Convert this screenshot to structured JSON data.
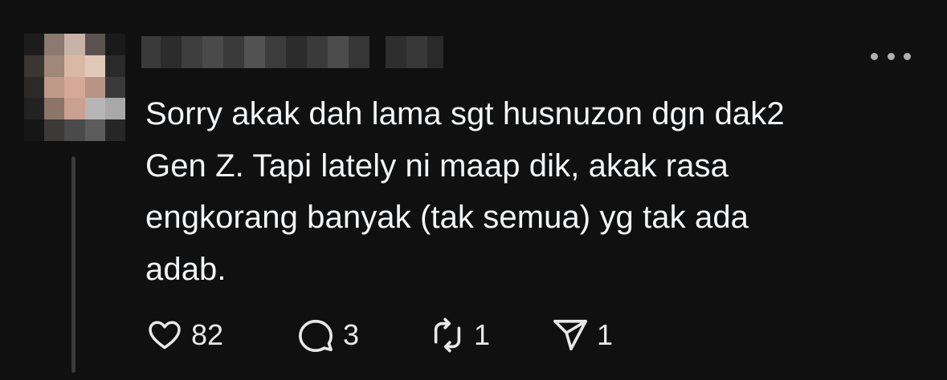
{
  "post": {
    "username_redacted": true,
    "text": "Sorry akak dah lama sgt husnuzon dgn dak2\nGen Z. Tapi lately ni maap dik, akak rasa\nengkorang banyak (tak semua) yg tak ada\nadab."
  },
  "menu": {
    "icon": "more-horizontal-icon"
  },
  "actions": {
    "like": {
      "icon": "heart-icon",
      "count": "82"
    },
    "reply": {
      "icon": "comment-icon",
      "count": "3"
    },
    "repost": {
      "icon": "repost-icon",
      "count": "1"
    },
    "share": {
      "icon": "send-icon",
      "count": "1"
    }
  },
  "colors": {
    "background": "#101010",
    "text": "#f3f5f7",
    "icon": "#e8e8e8",
    "thread_line": "#3a3a3a"
  }
}
